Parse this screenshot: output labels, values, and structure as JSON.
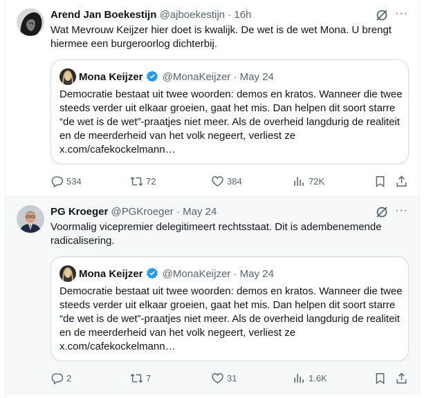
{
  "tweets": [
    {
      "author_name": "Arend Jan Boekestijn",
      "handle": "@ajboekestijn",
      "separator": "·",
      "time": "16h",
      "text": "Wat Mevrouw Keijzer hier doet is kwalijk. De wet is de wet Mona. U brengt hiermee een burgeroorlog dichterbij.",
      "more_label": "···",
      "quote": {
        "author_name": "Mona Keijzer",
        "handle": "@MonaKeijzer",
        "separator": "·",
        "time": "May 24",
        "text": "Democratie bestaat uit twee woorden: demos en kratos. Wanneer die twee steeds verder uit elkaar groeien, gaat het mis. Dan helpen dit soort starre “de wet is de wet”-praatjes niet meer. Als de overheid langdurig de realiteit en de meerderheid van het volk negeert, verliest ze x.com/cafekockelmann…"
      },
      "stats": {
        "replies": "534",
        "reposts": "72",
        "likes": "384",
        "views": "72K"
      }
    },
    {
      "author_name": "PG Kroeger",
      "handle": "@PGKroeger",
      "separator": "·",
      "time": "May 24",
      "text": "Voormalig vicepremier delegitimeert rechtsstaat. Dit is adembenemende radicalisering.",
      "more_label": "···",
      "quote": {
        "author_name": "Mona Keijzer",
        "handle": "@MonaKeijzer",
        "separator": "·",
        "time": "May 24",
        "text": "Democratie bestaat uit twee woorden: demos en kratos. Wanneer die twee steeds verder uit elkaar groeien, gaat het mis. Dan helpen dit soort starre “de wet is de wet”-praatjes niet meer. Als de overheid langdurig de realiteit en de meerderheid van het volk negeert, verliest ze x.com/cafekockelmann…"
      },
      "stats": {
        "replies": "2",
        "reposts": "7",
        "likes": "31",
        "views": "1.6K"
      }
    }
  ],
  "colors": {
    "text": "#0f1419",
    "secondary": "#536471",
    "verified": "#1d9bf0",
    "border": "#cfd9de",
    "highlight_bg": "#f7f9f9"
  },
  "icons": [
    "reply-icon",
    "repost-icon",
    "like-icon",
    "views-icon",
    "bookmark-icon",
    "share-icon",
    "grok-icon",
    "verified-badge-icon"
  ]
}
